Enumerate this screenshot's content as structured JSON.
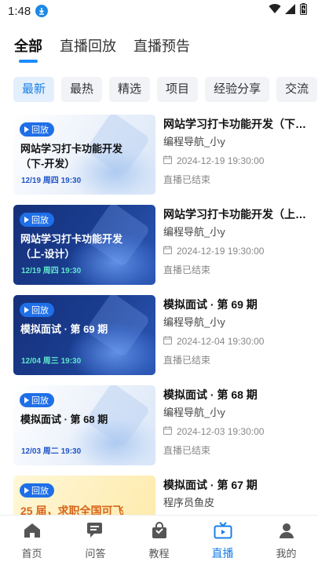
{
  "status": {
    "time": "1:48"
  },
  "top_tabs": [
    {
      "label": "全部",
      "active": true
    },
    {
      "label": "直播回放",
      "active": false
    },
    {
      "label": "直播预告",
      "active": false
    }
  ],
  "filters": [
    {
      "label": "最新",
      "active": true
    },
    {
      "label": "最热",
      "active": false
    },
    {
      "label": "精选",
      "active": false
    },
    {
      "label": "项目",
      "active": false
    },
    {
      "label": "经验分享",
      "active": false
    },
    {
      "label": "交流",
      "active": false
    }
  ],
  "items": [
    {
      "badge": "回放",
      "thumb_title": "网站学习打卡功能开发（下-开发）",
      "thumb_date": "12/19 周四 19:30",
      "title": "网站学习打卡功能开发（下…",
      "author": "编程导航_小y",
      "time": "2024-12-19 19:30:00",
      "status": "直播已结束",
      "theme": "light"
    },
    {
      "badge": "回放",
      "thumb_title": "网站学习打卡功能开发（上-设计）",
      "thumb_date": "12/19 周四 19:30",
      "title": "网站学习打卡功能开发（上…",
      "author": "编程导航_小y",
      "time": "2024-12-19 19:30:00",
      "status": "直播已结束",
      "theme": "dark"
    },
    {
      "badge": "回放",
      "thumb_title": "模拟面试 · 第 69 期",
      "thumb_date": "12/04 周三 19:30",
      "title": "模拟面试 · 第 69 期",
      "author": "编程导航_小y",
      "time": "2024-12-04 19:30:00",
      "status": "直播已结束",
      "theme": "dark"
    },
    {
      "badge": "回放",
      "thumb_title": "模拟面试 · 第 68 期",
      "thumb_date": "12/03 周二 19:30",
      "title": "模拟面试 · 第 68 期",
      "author": "编程导航_小y",
      "time": "2024-12-03 19:30:00",
      "status": "直播已结束",
      "theme": "light"
    },
    {
      "badge": "回放",
      "thumb_title": "25 届，求职全国可飞",
      "thumb_date": "",
      "title": "模拟面试 · 第 67 期",
      "author": "程序员鱼皮",
      "time": "",
      "status": "",
      "theme": "light"
    }
  ],
  "bottom_nav": [
    {
      "label": "首页",
      "icon": "home-icon",
      "active": false
    },
    {
      "label": "问答",
      "icon": "chat-icon",
      "active": false
    },
    {
      "label": "教程",
      "icon": "bag-icon",
      "active": false
    },
    {
      "label": "直播",
      "icon": "tv-icon",
      "active": true
    },
    {
      "label": "我的",
      "icon": "user-icon",
      "active": false
    }
  ],
  "colors": {
    "accent": "#1a7fe8",
    "chip_active_bg": "#e3effc",
    "chip_bg": "#f1f3f6"
  }
}
